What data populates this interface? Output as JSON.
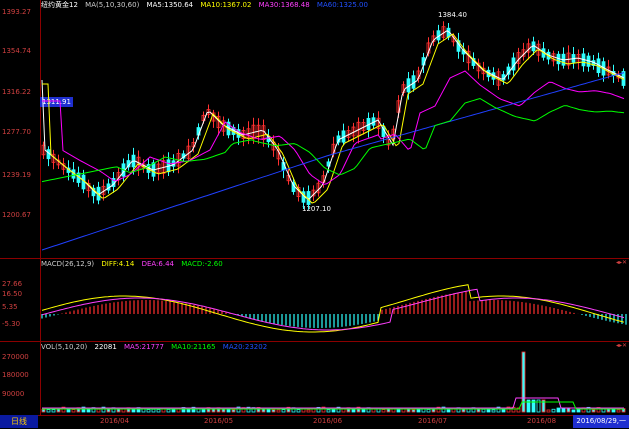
{
  "main_pane": {
    "title": "纽约黄金12",
    "ma_params": "MA(5,10,30,60)",
    "ma5": "MA5:1350.64",
    "ma10": "MA10:1367.02",
    "ma30": "MA30:1368.48",
    "ma60": "MA60:1325.00",
    "y_labels": [
      "1393.27",
      "1354.74",
      "1316.22",
      "1277.70",
      "1239.19",
      "1200.67"
    ],
    "last_price": "1311.91",
    "high_annotation": "1384.40",
    "low_annotation": "1207.10",
    "colors": {
      "ma5": "#ffffff",
      "ma10": "#ffff00",
      "ma30": "#ff00ff",
      "ma60": "#00ff00",
      "ma_long": "#2040ff",
      "up": "#ff3030",
      "down": "#30ffff"
    }
  },
  "macd_pane": {
    "label": "MACD(26,12,9)",
    "diff": "DIFF:4.14",
    "dea": "DEA:6.44",
    "macd": "MACD:-2.60",
    "y_labels": [
      "27.66",
      "16.50",
      "5.35",
      "-5.30"
    ]
  },
  "vol_pane": {
    "label": "VOL(5,10,20)",
    "vol": "22081",
    "ma5": "MA5:21777",
    "ma10": "MA10:21165",
    "ma20": "MA20:23202",
    "y_labels": [
      "270000",
      "180000",
      "90000"
    ]
  },
  "date_axis": {
    "period_tab": "日线",
    "months": [
      "2016/04",
      "2016/05",
      "2016/06",
      "2016/07",
      "2016/08"
    ],
    "current_date": "2016/08/29,一"
  }
}
